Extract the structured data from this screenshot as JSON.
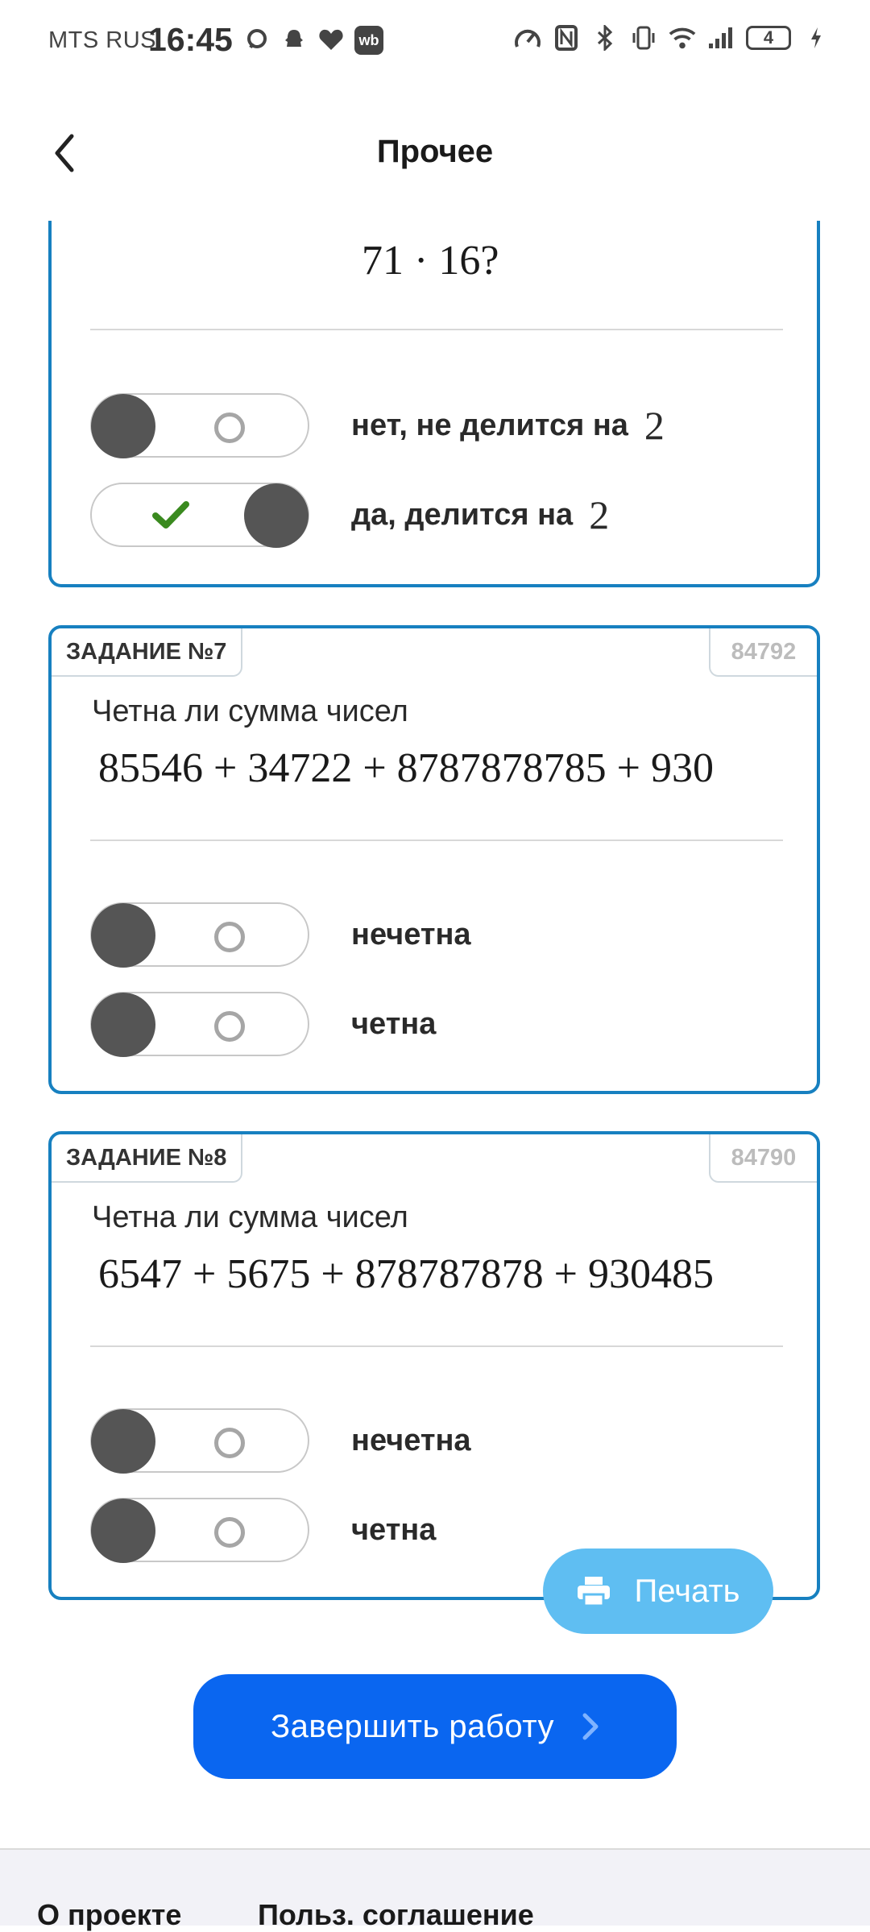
{
  "status_bar": {
    "carrier": "MTS RUS",
    "time": "16:45",
    "battery": "4"
  },
  "header": {
    "title": "Прочее"
  },
  "task6": {
    "math": "71 · 16?",
    "options": [
      {
        "label": "нет, не делится на",
        "math": "2",
        "selected": false
      },
      {
        "label": "да, делится на",
        "math": "2",
        "selected": true
      }
    ]
  },
  "task7": {
    "tab": "ЗАДАНИЕ №7",
    "id": "84792",
    "question": "Четна ли сумма чисел",
    "math": "85546 + 34722 + 8787878785 + 930",
    "options": [
      {
        "label": "нечетна",
        "selected": false
      },
      {
        "label": "четна",
        "selected": false
      }
    ]
  },
  "task8": {
    "tab": "ЗАДАНИЕ №8",
    "id": "84790",
    "question": "Четна ли сумма чисел",
    "math": "6547 + 5675 + 878787878 + 930485",
    "options": [
      {
        "label": "нечетна",
        "selected": false
      },
      {
        "label": "четна",
        "selected": false
      }
    ]
  },
  "print_button": {
    "label": "Печать"
  },
  "finish_button": {
    "label": "Завершить работу"
  },
  "footer": {
    "about": "О проекте",
    "terms": "Польз. соглашение"
  },
  "colors": {
    "card_border": "#1780c0",
    "finish": "#0a66f0",
    "print": "#5fbef2",
    "check": "#3a8a1f"
  }
}
